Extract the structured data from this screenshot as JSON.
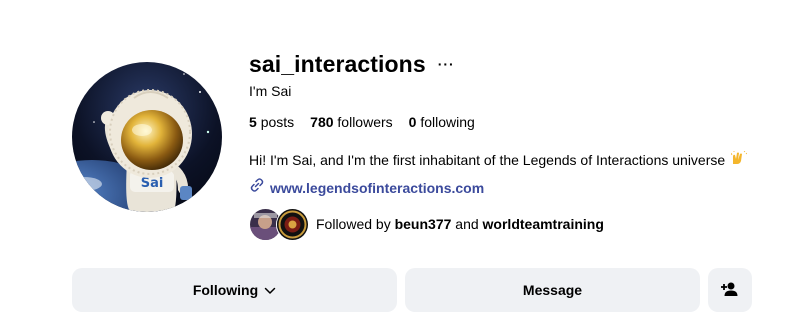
{
  "profile": {
    "username": "sai_interactions",
    "more_label": "···",
    "full_name": "I'm Sai",
    "stats": {
      "posts_count": "5",
      "posts_label": "posts",
      "followers_count": "780",
      "followers_label": "followers",
      "following_count": "0",
      "following_label": "following"
    },
    "bio": "Hi! I'm Sai, and I'm the first inhabitant of the Legends of Interactions universe",
    "bio_emoji": "🙌",
    "link": "www.legendsofinteractions.com",
    "avatar_text": "Sai",
    "followed_by": {
      "prefix": "Followed by",
      "user1": "beun377",
      "conjunction": "and",
      "user2": "worldteamtraining"
    }
  },
  "actions": {
    "following_label": "Following",
    "message_label": "Message"
  },
  "icons": {
    "more": "more-options-icon",
    "link": "link-icon",
    "dropdown": "chevron-down-icon",
    "add_user": "add-user-icon"
  },
  "colors": {
    "link": "#3b4a9c",
    "button_bg": "#eff1f4"
  }
}
